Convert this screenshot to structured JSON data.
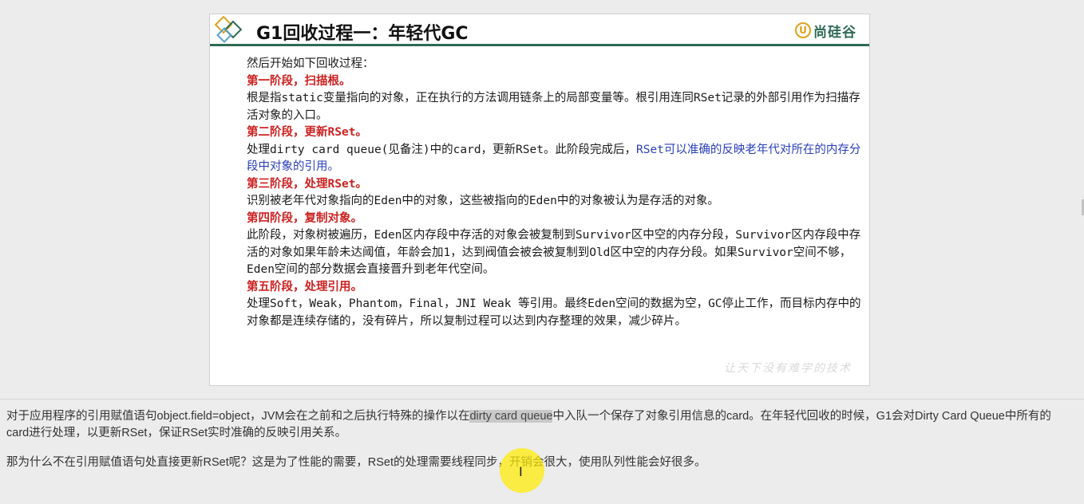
{
  "slide": {
    "title": "G1回收过程一：年轻代GC",
    "brand": {
      "icon_letter": "U",
      "text": "尚硅谷"
    },
    "intro": "然后开始如下回收过程：",
    "phases": [
      {
        "heading": "第一阶段，扫描根。",
        "body": "根是指static变量指向的对象，正在执行的方法调用链条上的局部变量等。根引用连同RSet记录的外部引用作为扫描存活对象的入口。"
      },
      {
        "heading": "第二阶段，更新RSet。",
        "body": "处理dirty card queue(见备注)中的card，更新RSet。此阶段完成后，",
        "body_highlight": "RSet可以准确的反映老年代对所在的内存分段中对象的引用。"
      },
      {
        "heading": "第三阶段，处理RSet。",
        "body": "识别被老年代对象指向的Eden中的对象，这些被指向的Eden中的对象被认为是存活的对象。"
      },
      {
        "heading": "第四阶段，复制对象。",
        "body": "此阶段，对象树被遍历，Eden区内存段中存活的对象会被复制到Survivor区中空的内存分段，Survivor区内存段中存活的对象如果年龄未达阈值，年龄会加1，达到阀值会被会被复制到Old区中空的内存分段。如果Survivor空间不够，Eden空间的部分数据会直接晋升到老年代空间。"
      },
      {
        "heading": "第五阶段，处理引用。",
        "body": "处理Soft，Weak，Phantom，Final，JNI Weak 等引用。最终Eden空间的数据为空，GC停止工作，而目标内存中的对象都是连续存储的，没有碎片，所以复制过程可以达到内存整理的效果，减少碎片。"
      }
    ],
    "watermark": "让天下没有难学的技术"
  },
  "notes": {
    "para1_before": "对于应用程序的引用赋值语句object.field=object，JVM会在之前和之后执行特殊的操作以在",
    "para1_highlight": "dirty card queue",
    "para1_after": "中入队一个保存了对象引用信息的card。在年轻代回收的时候，G1会对Dirty Card Queue中所有的card进行处理，以更新RSet，保证RSet实时准确的反映引用关系。",
    "para2": "那为什么不在引用赋值语句处直接更新RSet呢？这是为了性能的需要，RSet的处理需要线程同步，开销会很大，使用队列性能会好很多。"
  },
  "colors": {
    "header_rule": "#2f6a55",
    "phase_heading": "#cc2222",
    "highlight_text": "#2a3fb8",
    "brand_accent": "#e0a21b",
    "cursor_highlight": "#ffec00"
  },
  "icons": [
    "diamond-logo-icon",
    "brand-logo-icon",
    "text-cursor-icon"
  ]
}
